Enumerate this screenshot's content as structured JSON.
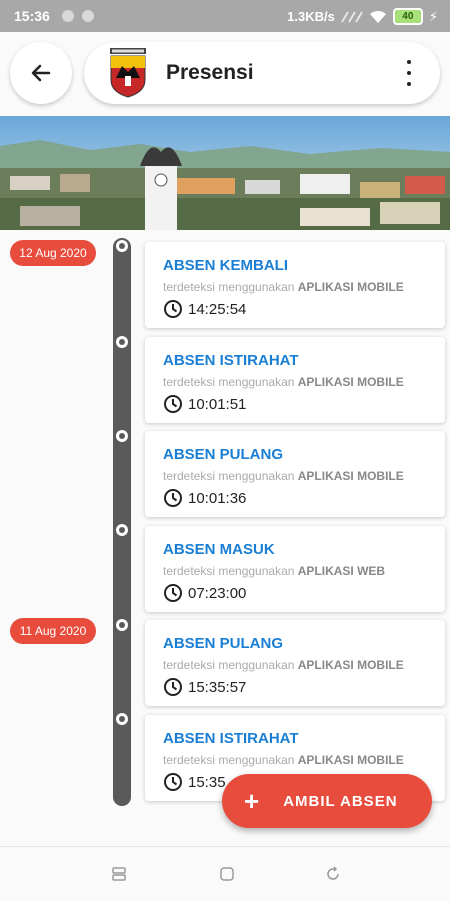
{
  "status_bar": {
    "time": "15:36",
    "speed": "1.3KB/s",
    "battery": "40"
  },
  "header": {
    "title": "Presensi"
  },
  "timeline": {
    "dates": [
      "12 Aug 2020",
      "11 Aug 2020"
    ],
    "entries": [
      {
        "title": "ABSEN KEMBALI",
        "prefix": "terdeteksi menggunakan",
        "method": "APLIKASI MOBILE",
        "time": "14:25:54"
      },
      {
        "title": "ABSEN ISTIRAHAT",
        "prefix": "terdeteksi menggunakan",
        "method": "APLIKASI MOBILE",
        "time": "10:01:51"
      },
      {
        "title": "ABSEN PULANG",
        "prefix": "terdeteksi menggunakan",
        "method": "APLIKASI MOBILE",
        "time": "10:01:36"
      },
      {
        "title": "ABSEN MASUK",
        "prefix": "terdeteksi menggunakan",
        "method": "APLIKASI WEB",
        "time": "07:23:00"
      },
      {
        "title": "ABSEN PULANG",
        "prefix": "terdeteksi menggunakan",
        "method": "APLIKASI MOBILE",
        "time": "15:35:57"
      },
      {
        "title": "ABSEN ISTIRAHAT",
        "prefix": "terdeteksi menggunakan",
        "method": "APLIKASI MOBILE",
        "time": "15:35"
      }
    ]
  },
  "fab": {
    "label": "AMBIL ABSEN"
  },
  "colors": {
    "accent": "#e84c3d",
    "title_blue": "#1a7fd4",
    "timeline": "#5a5a5a"
  }
}
